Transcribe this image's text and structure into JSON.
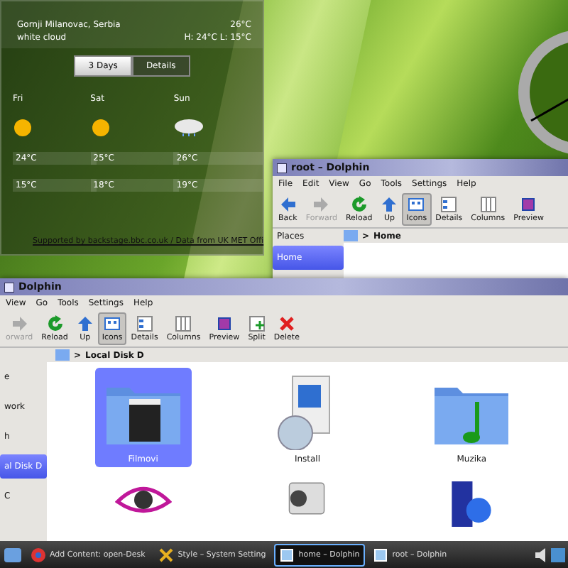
{
  "weather": {
    "location": "Gornji Milanovac, Serbia",
    "condition": "white cloud",
    "temperature": "26°C",
    "high_low": "H: 24°C L: 15°C",
    "tabs": [
      {
        "label": "3 Days",
        "selected": true
      },
      {
        "label": "Details",
        "selected": false
      }
    ],
    "days": [
      {
        "name": "Fri",
        "kind": "sun",
        "high": "24°C",
        "low": "15°C"
      },
      {
        "name": "Sat",
        "kind": "sun",
        "high": "25°C",
        "low": "18°C"
      },
      {
        "name": "Sun",
        "kind": "rain",
        "high": "26°C",
        "low": "19°C"
      }
    ],
    "credit": "Supported by backstage.bbc.co.uk / Data from UK MET Offi"
  },
  "windows": [
    {
      "title": "root – Dolphin",
      "menu": [
        "File",
        "Edit",
        "View",
        "Go",
        "Tools",
        "Settings",
        "Help"
      ],
      "toolbar": [
        {
          "label": "Back",
          "kind": "back",
          "selected": false,
          "disabled": false
        },
        {
          "label": "Forward",
          "kind": "forward",
          "selected": false,
          "disabled": true
        },
        {
          "label": "Reload",
          "kind": "reload",
          "selected": false,
          "disabled": false
        },
        {
          "label": "Up",
          "kind": "up",
          "selected": false,
          "disabled": false
        },
        {
          "label": "Icons",
          "kind": "icons",
          "selected": true,
          "disabled": false
        },
        {
          "label": "Details",
          "kind": "details",
          "selected": false,
          "disabled": false
        },
        {
          "label": "Columns",
          "kind": "columns",
          "selected": false,
          "disabled": false
        },
        {
          "label": "Preview",
          "kind": "preview",
          "selected": false,
          "disabled": false
        }
      ],
      "places_title": "Places",
      "places": [
        {
          "label": "Home",
          "selected": true
        }
      ],
      "separator": ">",
      "breadcrumb": "Home"
    },
    {
      "title": "Dolphin",
      "menu": [
        "View",
        "Go",
        "Tools",
        "Settings",
        "Help"
      ],
      "toolbar": [
        {
          "label": "orward",
          "kind": "forward",
          "selected": false,
          "disabled": true
        },
        {
          "label": "Reload",
          "kind": "reload",
          "selected": false,
          "disabled": false
        },
        {
          "label": "Up",
          "kind": "up",
          "selected": false,
          "disabled": false
        },
        {
          "label": "Icons",
          "kind": "icons",
          "selected": true,
          "disabled": false
        },
        {
          "label": "Details",
          "kind": "details",
          "selected": false,
          "disabled": false
        },
        {
          "label": "Columns",
          "kind": "columns",
          "selected": false,
          "disabled": false
        },
        {
          "label": "Preview",
          "kind": "preview",
          "selected": false,
          "disabled": false
        },
        {
          "label": "Split",
          "kind": "split",
          "selected": false,
          "disabled": false
        },
        {
          "label": "Delete",
          "kind": "delete",
          "selected": false,
          "disabled": false
        }
      ],
      "places": [
        {
          "label": "e",
          "selected": false
        },
        {
          "label": "work",
          "selected": false
        },
        {
          "label": "h",
          "selected": false
        },
        {
          "label": "al Disk D",
          "selected": true
        },
        {
          "label": "C",
          "selected": false
        }
      ],
      "separator": ">",
      "breadcrumb": "Local Disk D",
      "files": [
        {
          "label": "Filmovi",
          "kind": "video-folder",
          "selected": true
        },
        {
          "label": "Install",
          "kind": "package",
          "selected": false
        },
        {
          "label": "Muzika",
          "kind": "music-folder",
          "selected": false
        },
        {
          "kind": "eye",
          "selected": false
        },
        {
          "kind": "camera",
          "selected": false
        },
        {
          "kind": "computer",
          "selected": false
        }
      ]
    }
  ],
  "taskbar": [
    {
      "label": "Add Content: open-Desk",
      "kind": "browser",
      "selected": false
    },
    {
      "label": "Style – System Setting",
      "kind": "tools",
      "selected": false
    },
    {
      "label": "home – Dolphin",
      "kind": "window",
      "selected": true
    },
    {
      "label": "root – Dolphin",
      "kind": "window",
      "selected": false
    }
  ]
}
